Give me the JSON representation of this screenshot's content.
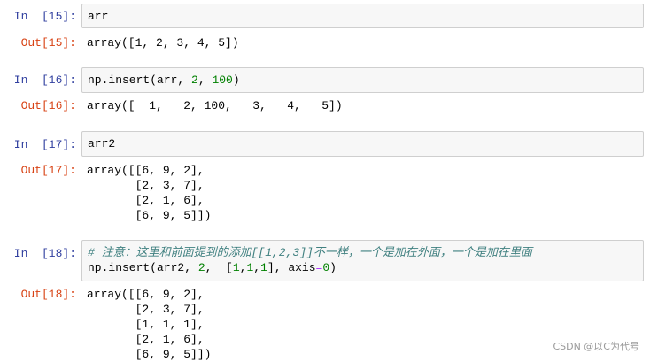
{
  "cells": [
    {
      "in_prompt": "In  [15]:",
      "code": [
        "arr"
      ],
      "out_prompt": "Out[15]:",
      "output": [
        "array([1, 2, 3, 4, 5])"
      ]
    },
    {
      "in_prompt": "In  [16]:",
      "code_parts": {
        "pre": "np.insert(arr, ",
        "n1": "2",
        "mid": ", ",
        "n2": "100",
        "post": ")"
      },
      "out_prompt": "Out[16]:",
      "output": [
        "array([  1,   2, 100,   3,   4,   5])"
      ]
    },
    {
      "in_prompt": "In  [17]:",
      "code": [
        "arr2"
      ],
      "out_prompt": "Out[17]:",
      "output": [
        "array([[6, 9, 2],",
        "       [2, 3, 7],",
        "       [2, 1, 6],",
        "       [6, 9, 5]])"
      ]
    },
    {
      "in_prompt": "In  [18]:",
      "comment": "# 注意：这里和前面提到的添加[[1,2,3]]不一样，一个是加在外面，一个是加在里面",
      "code_parts": {
        "pre": "np.insert(arr2, ",
        "n1": "2",
        "mid": ",  [",
        "n2": "1",
        "c1": ",",
        "n3": "1",
        "c2": ",",
        "n4": "1",
        "mid2": "], axis",
        "eq": "=",
        "n5": "0",
        "post": ")"
      },
      "out_prompt": "Out[18]:",
      "output": [
        "array([[6, 9, 2],",
        "       [2, 3, 7],",
        "       [1, 1, 1],",
        "       [2, 1, 6],",
        "       [6, 9, 5]])"
      ]
    }
  ],
  "watermark": "CSDN @以C为代号"
}
